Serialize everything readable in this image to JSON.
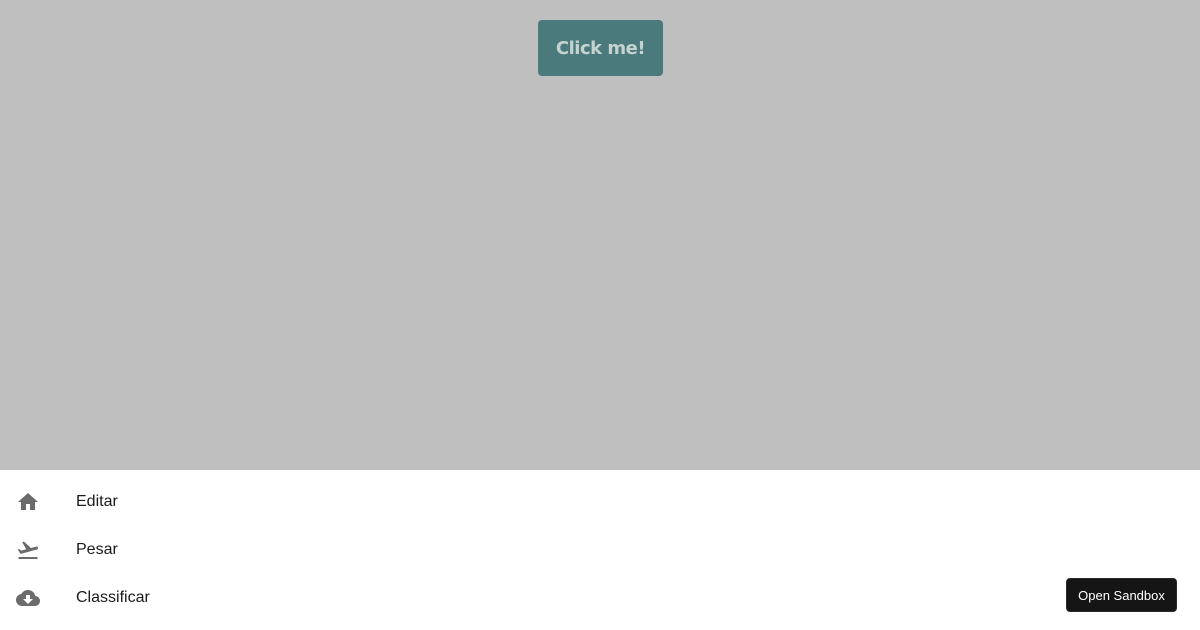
{
  "canvas": {
    "button_label": "Click me!"
  },
  "menu": {
    "items": [
      {
        "label": "Editar",
        "icon": "home-icon"
      },
      {
        "label": "Pesar",
        "icon": "flight-takeoff-icon"
      },
      {
        "label": "Classificar",
        "icon": "cloud-download-icon"
      }
    ]
  },
  "sandbox": {
    "button_label": "Open Sandbox"
  },
  "colors": {
    "backdrop": "#bfbfbf",
    "button_background": "#4a7a7c",
    "button_text": "#c6d2cf",
    "icon": "#6b6b6b",
    "sandbox_button": "#151515"
  }
}
